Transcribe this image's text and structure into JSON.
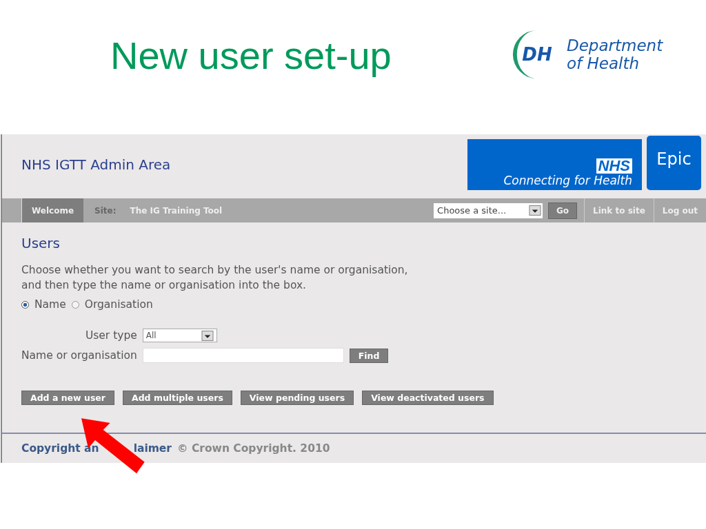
{
  "slide_title": "New user set-up",
  "logo": {
    "mark": "DH",
    "lines": [
      "Department",
      "of Health"
    ]
  },
  "app": {
    "title": "NHS IGTT Admin Area",
    "nhs_logo": {
      "mark": "NHS",
      "tagline": "Connecting for Health"
    },
    "epic_badge": "Epic"
  },
  "nav": {
    "tabs": [
      {
        "label": "Welcome",
        "selected": true
      }
    ],
    "site_label": "Site:",
    "site_name": "The IG Training Tool",
    "site_select": {
      "value": "Choose a site..."
    },
    "go_button": "Go",
    "links": [
      "Link to site",
      "Log out"
    ]
  },
  "page": {
    "heading": "Users",
    "intro": "Choose whether you want to search by the user's name or organisation,\nand then type the name or organisation into the box.",
    "search_by": [
      {
        "label": "Name",
        "selected": true
      },
      {
        "label": "Organisation",
        "selected": false
      }
    ],
    "user_type": {
      "label": "User type",
      "value": "All"
    },
    "name_field": {
      "label": "Name or organisation"
    },
    "find_button": "Find",
    "actions": [
      "Add a new user",
      "Add multiple users",
      "View pending users",
      "View deactivated users"
    ]
  },
  "footer": {
    "link_parts": [
      "Copyright an",
      "laimer"
    ],
    "text": "© Crown Copyright. 2010"
  }
}
